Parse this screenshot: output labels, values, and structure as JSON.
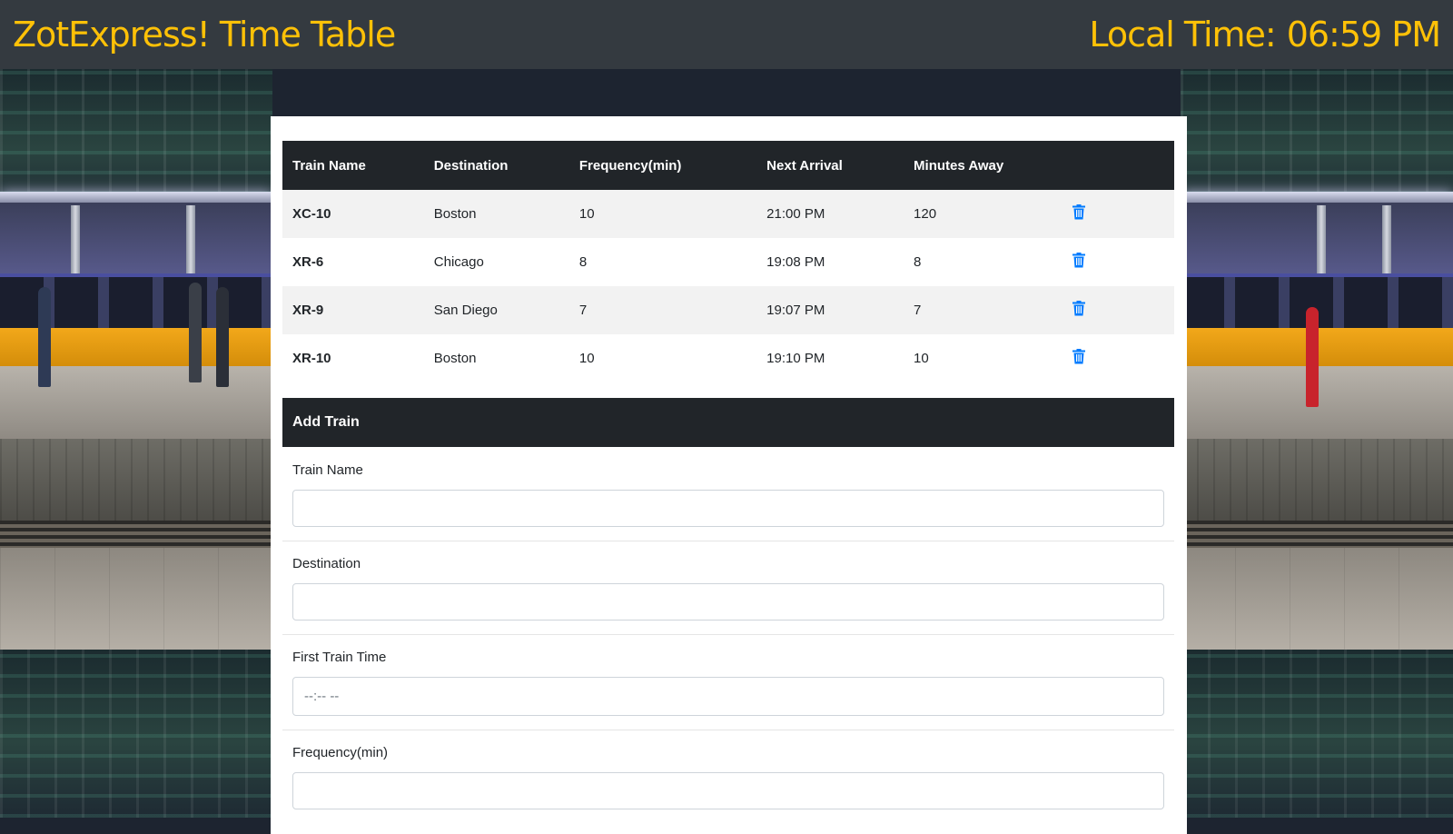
{
  "header": {
    "title": "ZotExpress! Time Table",
    "clock_label": "Local Time:",
    "clock_time": "06:59 PM",
    "accent_color": "#ffc107"
  },
  "table": {
    "columns": [
      "Train Name",
      "Destination",
      "Frequency(min)",
      "Next Arrival",
      "Minutes Away"
    ],
    "rows": [
      {
        "name": "XC-10",
        "destination": "Boston",
        "frequency": "10",
        "next_arrival": "21:00 PM",
        "minutes_away": "120"
      },
      {
        "name": "XR-6",
        "destination": "Chicago",
        "frequency": "8",
        "next_arrival": "19:08 PM",
        "minutes_away": "8"
      },
      {
        "name": "XR-9",
        "destination": "San Diego",
        "frequency": "7",
        "next_arrival": "19:07 PM",
        "minutes_away": "7"
      },
      {
        "name": "XR-10",
        "destination": "Boston",
        "frequency": "10",
        "next_arrival": "19:10 PM",
        "minutes_away": "10"
      }
    ],
    "delete_icon": "trash-icon",
    "delete_color": "#007bff"
  },
  "form": {
    "title": "Add Train",
    "fields": [
      {
        "label": "Train Name",
        "value": "",
        "placeholder": ""
      },
      {
        "label": "Destination",
        "value": "",
        "placeholder": ""
      },
      {
        "label": "First Train Time",
        "value": "",
        "placeholder": "--:-- --"
      },
      {
        "label": "Frequency(min)",
        "value": "",
        "placeholder": ""
      }
    ]
  }
}
